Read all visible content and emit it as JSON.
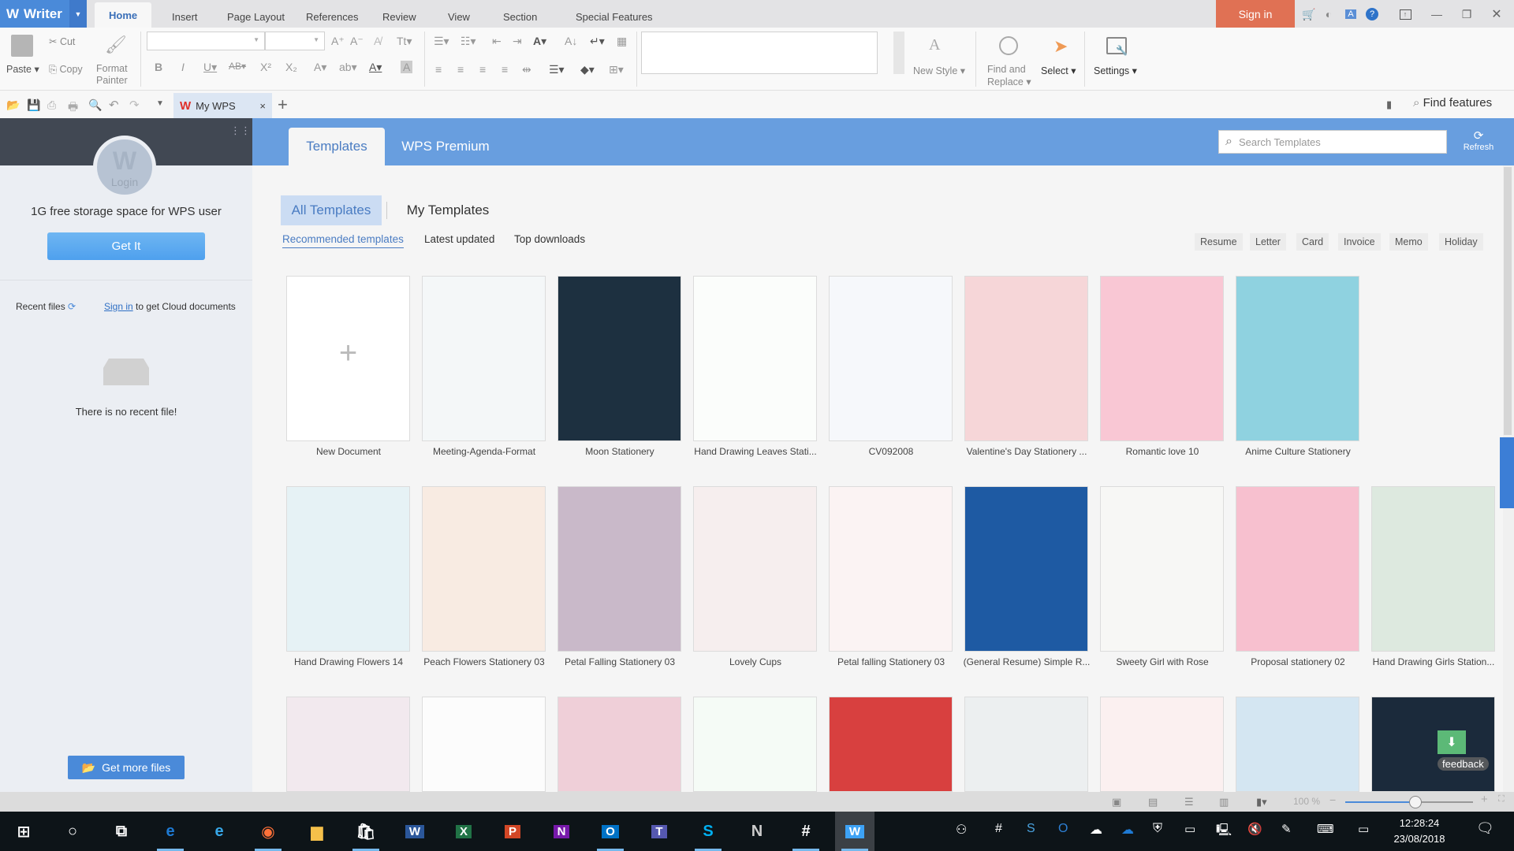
{
  "app": {
    "name": "Writer",
    "logo_glyph": "W"
  },
  "menu_tabs": [
    {
      "label": "Home",
      "active": true
    },
    {
      "label": "Insert"
    },
    {
      "label": "Page Layout"
    },
    {
      "label": "References"
    },
    {
      "label": "Review"
    },
    {
      "label": "View"
    },
    {
      "label": "Section"
    },
    {
      "label": "Special Features"
    }
  ],
  "titlebar": {
    "sign_in": "Sign in",
    "icons": [
      "cart-icon",
      "skin-icon",
      "doc-a-icon",
      "help-icon",
      "collapse-ribbon-icon",
      "minimize-icon",
      "restore-icon",
      "close-icon"
    ]
  },
  "ribbon": {
    "paste": "Paste",
    "cut": "Cut",
    "copy": "Copy",
    "format_painter_1": "Format",
    "format_painter_2": "Painter",
    "font_name": "",
    "font_size": "",
    "new_style": "New Style",
    "find_replace_1": "Find and",
    "find_replace_2": "Replace",
    "select": "Select",
    "settings": "Settings"
  },
  "quick_access": {
    "find_features": "Find features"
  },
  "doc_tabs": [
    {
      "label": "My WPS",
      "active": true
    }
  ],
  "left_panel": {
    "avatar_label": "Login",
    "storage_text": "1G free storage space for WPS user",
    "get_it": "Get It",
    "recent_files": "Recent files",
    "sign_in_link": "Sign in",
    "cloud_text": "to get Cloud documents",
    "no_recent": "There is no recent file!",
    "get_more": "Get more files"
  },
  "header": {
    "tabs": [
      {
        "label": "Templates",
        "active": true
      },
      {
        "label": "WPS Premium"
      }
    ],
    "search_placeholder": "Search Templates",
    "refresh": "Refresh"
  },
  "templates": {
    "main_tabs": [
      {
        "label": "All Templates",
        "active": true
      },
      {
        "label": "My Templates"
      }
    ],
    "filters": [
      {
        "label": "Recommended templates",
        "active": true
      },
      {
        "label": "Latest updated"
      },
      {
        "label": "Top downloads"
      }
    ],
    "categories": [
      "Resume",
      "Letter",
      "Card",
      "Invoice",
      "Memo",
      "Holiday"
    ],
    "row1": [
      {
        "name": "New Document",
        "bg": "#ffffff"
      },
      {
        "name": "Meeting-Agenda-Format",
        "bg": "#f4f7f8"
      },
      {
        "name": "Moon Stationery",
        "bg": "#1d3040"
      },
      {
        "name": "Hand Drawing Leaves Stati...",
        "bg": "#fbfdfb"
      },
      {
        "name": "CV092008",
        "bg": "#f6f8fb"
      },
      {
        "name": "Valentine's Day Stationery ...",
        "bg": "#f6d6d8"
      },
      {
        "name": "Romantic love 10",
        "bg": "#f9c7d4"
      },
      {
        "name": "Anime Culture Stationery",
        "bg": "#8fd2e0"
      }
    ],
    "row2": [
      {
        "name": "Hand Drawing Flowers 14",
        "bg": "#e6f2f5"
      },
      {
        "name": "Peach Flowers Stationery 03",
        "bg": "#f8ebe2"
      },
      {
        "name": "Petal Falling Stationery 03",
        "bg": "#c9b9c9"
      },
      {
        "name": "Lovely Cups",
        "bg": "#f6eeee"
      },
      {
        "name": "Petal falling Stationery 03",
        "bg": "#fbf3f3"
      },
      {
        "name": "(General Resume) Simple R...",
        "bg": "#1e5aa3"
      },
      {
        "name": "Sweety Girl with Rose",
        "bg": "#f7f7f5"
      },
      {
        "name": "Proposal stationery 02",
        "bg": "#f7c0cf"
      },
      {
        "name": "Hand Drawing Girls Station...",
        "bg": "#dde9df"
      }
    ],
    "row3": [
      {
        "bg": "#f2e9ee"
      },
      {
        "bg": "#fcfcfc"
      },
      {
        "bg": "#efcfd8"
      },
      {
        "bg": "#f5fbf6"
      },
      {
        "bg": "#d8403f"
      },
      {
        "bg": "#eceff0"
      },
      {
        "bg": "#fbf0f0"
      },
      {
        "bg": "#d4e6f2"
      },
      {
        "bg": "#1b2a3b"
      }
    ],
    "feedback": "feedback"
  },
  "statusbar": {
    "zoom": "100 %",
    "zoom_fraction": 0.55
  },
  "taskbar": {
    "apps": [
      "start",
      "search",
      "task-view",
      "edge",
      "ie",
      "firefox",
      "explorer",
      "store",
      "word",
      "excel",
      "powerpoint",
      "onenote",
      "outlook",
      "teams",
      "skype",
      "notion",
      "slack",
      "wps"
    ],
    "time": "12:28:24",
    "date": "23/08/2018"
  }
}
